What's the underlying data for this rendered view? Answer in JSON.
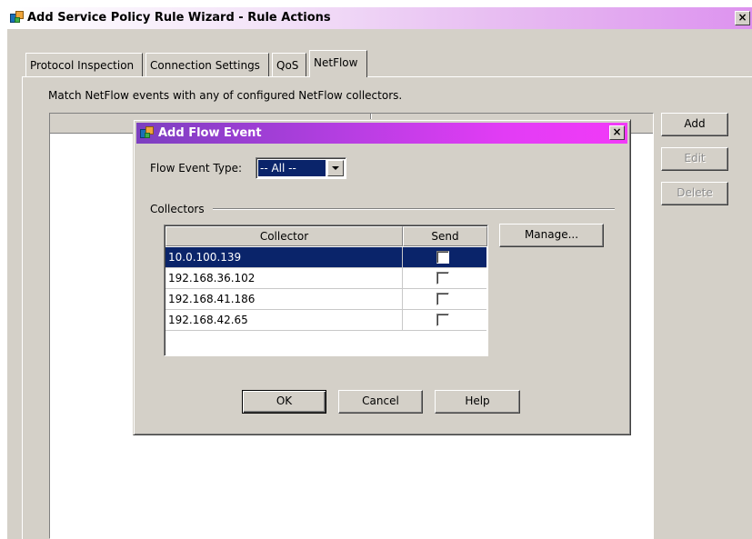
{
  "window": {
    "title": "Add Service Policy Rule Wizard - Rule Actions",
    "close_glyph": "×"
  },
  "tabs": [
    {
      "label": "Protocol Inspection"
    },
    {
      "label": "Connection Settings"
    },
    {
      "label": "QoS"
    },
    {
      "label": "NetFlow",
      "active": true
    }
  ],
  "main": {
    "description": "Match NetFlow events with any of configured NetFlow collectors.",
    "buttons": {
      "add": "Add",
      "edit": "Edit",
      "delete": "Delete"
    }
  },
  "dialog": {
    "title": "Add Flow Event",
    "close_glyph": "×",
    "flow_event_type_label": "Flow Event Type:",
    "flow_event_type_value": "-- All --",
    "collectors_group_label": "Collectors",
    "table": {
      "headers": [
        "Collector",
        "Send"
      ],
      "rows": [
        {
          "collector": "10.0.100.139",
          "send": false,
          "selected": true
        },
        {
          "collector": "192.168.36.102",
          "send": false,
          "selected": false
        },
        {
          "collector": "192.168.41.186",
          "send": false,
          "selected": false
        },
        {
          "collector": "192.168.42.65",
          "send": false,
          "selected": false
        }
      ]
    },
    "manage_button": "Manage...",
    "ok_button": "OK",
    "cancel_button": "Cancel",
    "help_button": "Help"
  },
  "colors": {
    "selection": "#0a246a",
    "face": "#d4d0c8",
    "dialog_title_start": "#7c3fc0",
    "dialog_title_end": "#f23af8"
  }
}
